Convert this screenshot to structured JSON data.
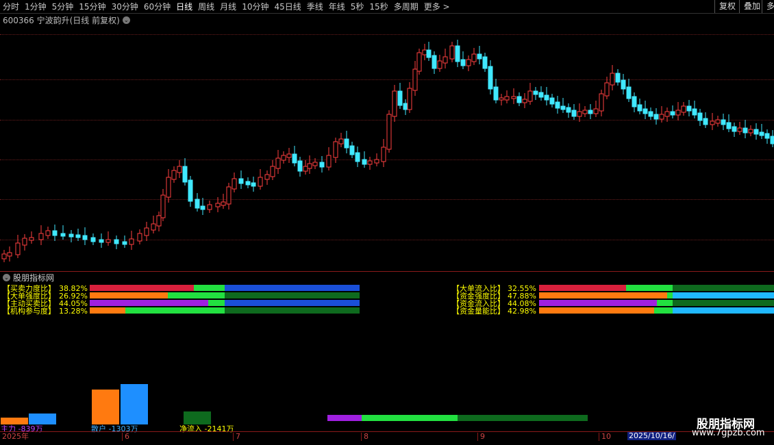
{
  "toolbar": {
    "tabs": [
      "分时",
      "1分钟",
      "5分钟",
      "15分钟",
      "30分钟",
      "60分钟",
      "日线",
      "周线",
      "月线",
      "10分钟",
      "45日线",
      "季线",
      "年线",
      "5秒",
      "15秒",
      "多周期",
      "更多 >"
    ],
    "active": "日线",
    "right_buttons": [
      "复权",
      "叠加",
      "多"
    ]
  },
  "stock": {
    "title": "600366 宁波韵升(日线 前复权)"
  },
  "indicator": {
    "title": "股朋指标网",
    "left_rows": [
      {
        "label": "【买卖力度比】",
        "value": "38.82%"
      },
      {
        "label": "【大单强度比】",
        "value": "26.92%"
      },
      {
        "label": "【主动买卖比】",
        "value": "44.05%"
      },
      {
        "label": "【机构参与度】",
        "value": "13.28%"
      }
    ],
    "right_rows": [
      {
        "label": "【大单流入比】",
        "value": "32.55%"
      },
      {
        "label": "【资金强度比】",
        "value": "47.88%"
      },
      {
        "label": "【资金流入比】",
        "value": "44.08%"
      },
      {
        "label": "【资金量能比】",
        "value": "42.98%"
      }
    ],
    "bottom": {
      "main_force": "主力 -839万",
      "retail": "散户 -1303万",
      "net_inflow": "净流入 -2141万"
    }
  },
  "date_axis": {
    "labels": [
      "2025年",
      "6",
      "7",
      "8",
      "9",
      "10"
    ],
    "current_date": "2025/10/16/"
  },
  "watermark": {
    "name": "股朋指标网",
    "url": "www.7gpzb.com"
  },
  "colors": {
    "up": "#ff4040",
    "down": "#40e8ff",
    "red": "#d8203c",
    "green": "#22e040",
    "dark_green": "#0e6a1e",
    "blue": "#1a4fd8",
    "orange": "#ff7a10",
    "purple": "#a020e0",
    "cyan": "#20b8ff",
    "label_yellow": "#ffff00"
  }
}
